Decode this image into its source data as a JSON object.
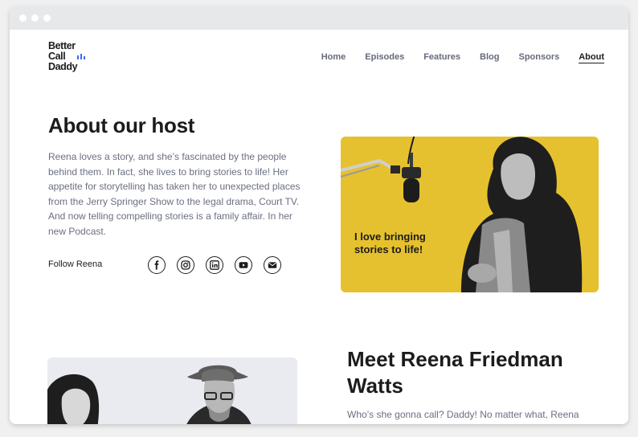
{
  "logo": {
    "line1": "Better",
    "line2": "Call",
    "line3": "Daddy"
  },
  "nav": {
    "items": [
      "Home",
      "Episodes",
      "Features",
      "Blog",
      "Sponsors",
      "About"
    ],
    "active": "About"
  },
  "about": {
    "heading": "About our host",
    "body": "Reena loves a story, and she’s fascinated by the people behind them. In fact, she lives to bring stories to life! Her appetite for storytelling has taken her to unexpected places from the Jerry Springer Show to the legal drama, Court TV. And now telling compelling stories is a family affair. In her new Podcast.",
    "follow_label": "Follow Reena",
    "socials": [
      "facebook-icon",
      "instagram-icon",
      "linkedin-icon",
      "youtube-icon",
      "email-icon"
    ],
    "quote": "I love bringing stories to life!"
  },
  "meet": {
    "heading": "Meet Reena Friedman Watts",
    "body": "Who’s she gonna call? Daddy! No matter what, Reena always calls her Dad for advice. He’s her expert system"
  },
  "colors": {
    "accent": "#e6c12f",
    "text": "#1c1c1c",
    "muted": "#6b6f82",
    "logo_accent": "#3b6cf6"
  }
}
